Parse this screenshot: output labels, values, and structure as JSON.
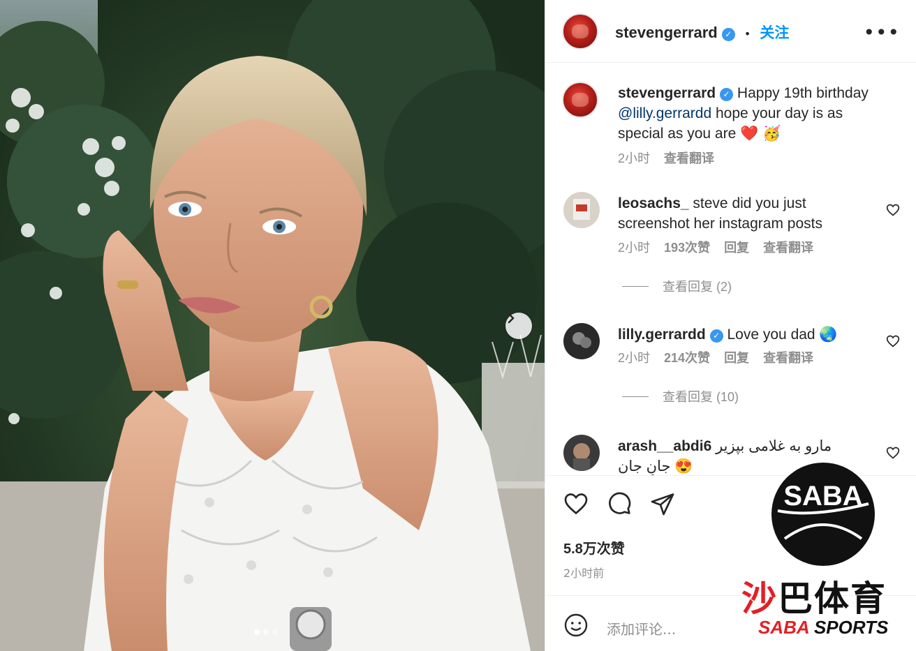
{
  "post": {
    "author": "stevengerrard",
    "follow_label": "关注",
    "more_label": "•••",
    "separator": "•",
    "image_slide_count": 3,
    "image_active_slide": 1
  },
  "caption": {
    "username": "stevengerrard",
    "text_before": "Happy 19th birthday ",
    "mention": "@lilly.gerrardd",
    "text_after": " hope your day is as special as you are ❤️ 🥳",
    "time": "2小时",
    "translate_label": "查看翻译"
  },
  "comments": [
    {
      "username": "leosachs_",
      "text": "steve did you just screenshot her instagram posts",
      "time": "2小时",
      "likes": "193次赞",
      "reply_label": "回复",
      "translate_label": "查看翻译",
      "view_replies": "查看回复 (2)"
    },
    {
      "username": "lilly.gerrardd",
      "text": "Love you dad 🌏",
      "time": "2小时",
      "likes": "214次赞",
      "reply_label": "回复",
      "translate_label": "查看翻译",
      "view_replies": "查看回复 (10)"
    },
    {
      "username": "arash__abdi6",
      "text": "مارو به غلامی بپزیر جانِ جان 😍"
    }
  ],
  "footer": {
    "likes_total": "5.8万次赞",
    "posted_time": "2小时前",
    "add_comment_placeholder": "添加评论..."
  },
  "watermark": {
    "logo_letters": "SABA",
    "chinese_red": "沙",
    "chinese_rest": "巴体育",
    "english_red": "SABA",
    "english_rest": " SPORTS"
  },
  "colors": {
    "link_blue": "#0095f6",
    "verified_blue": "#3897f0",
    "meta_gray": "#8e8e8e",
    "watermark_red": "#e31f26"
  },
  "icons": [
    "verified-badge-icon",
    "more-options-icon",
    "heart-icon",
    "comment-icon",
    "share-icon",
    "emoji-icon",
    "chevron-right-icon"
  ]
}
